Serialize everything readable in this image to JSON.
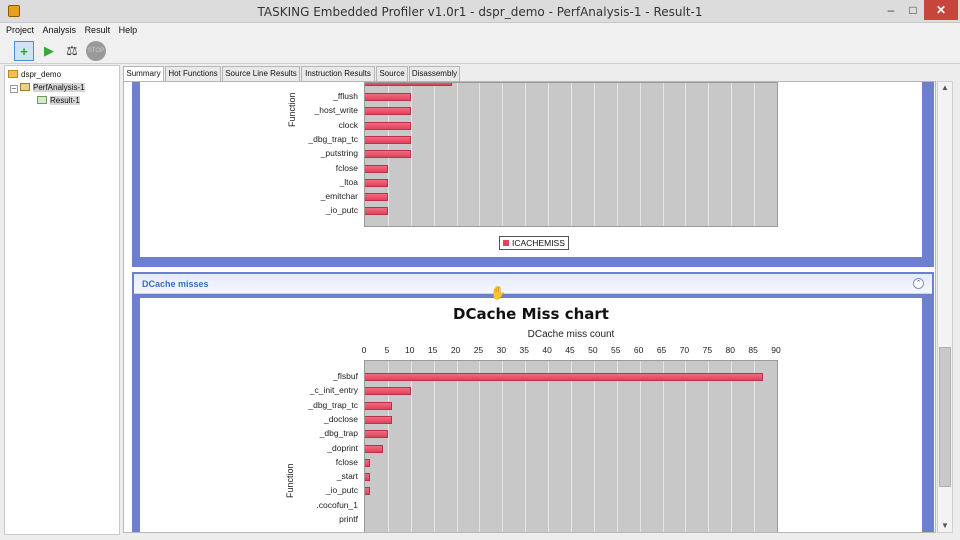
{
  "window": {
    "title": "TASKING Embedded Profiler v1.0r1 - dspr_demo - PerfAnalysis-1 - Result-1"
  },
  "menu": {
    "items": [
      "Project",
      "Analysis",
      "Result",
      "Help"
    ]
  },
  "toolbar": {
    "icons": [
      "new-analysis-icon",
      "run-icon",
      "compare-icon",
      "stop-icon"
    ]
  },
  "tree": {
    "project": "dspr_demo",
    "analysis": "PerfAnalysis-1",
    "result": "Result-1"
  },
  "tabs": [
    "Summary",
    "Hot Functions",
    "Source Line Results",
    "Instruction Results",
    "Source",
    "Disassembly"
  ],
  "active_tab": "Summary",
  "colors": {
    "bar": "#e2425e",
    "frame": "#6c80cf",
    "header_text": "#3a6fb5"
  },
  "icache_section": {
    "ylabel": "Function",
    "legend": "ICACHEMISS"
  },
  "dcache_section": {
    "header": "DCache misses",
    "title": "DCache Miss chart",
    "xlabel": "DCache miss count",
    "ylabel": "Function"
  },
  "chart_data": [
    {
      "type": "bar",
      "orientation": "horizontal",
      "title": "",
      "ylabel": "Function",
      "legend": [
        "ICACHEMISS"
      ],
      "legend_position": "bottom",
      "categories": [
        "_fflush",
        "_host_write",
        "clock",
        "_dbg_trap_tc",
        "_putstring",
        "fclose",
        "_ltoa",
        "_emitchar",
        "_io_putc"
      ],
      "values": [
        10,
        10,
        10,
        10,
        10,
        5,
        5,
        5,
        5
      ],
      "xlim": [
        0,
        90
      ],
      "partially_visible": true
    },
    {
      "type": "bar",
      "orientation": "horizontal",
      "title": "DCache Miss chart",
      "xlabel": "DCache miss count",
      "ylabel": "Function",
      "x_axis_position": "top",
      "xlim": [
        0,
        90
      ],
      "xticks": [
        0,
        5,
        10,
        15,
        20,
        25,
        30,
        35,
        40,
        45,
        50,
        55,
        60,
        65,
        70,
        75,
        80,
        85,
        90
      ],
      "categories": [
        "_flsbuf",
        "_c_init_entry",
        "_dbg_trap_tc",
        "_doclose",
        "_dbg_trap",
        "_doprint",
        "fclose",
        "_start",
        "_io_putc",
        ".cocofun_1",
        "printf"
      ],
      "values": [
        87,
        10,
        6,
        6,
        5,
        4,
        1,
        1,
        1,
        0,
        0
      ],
      "grid": true
    }
  ]
}
